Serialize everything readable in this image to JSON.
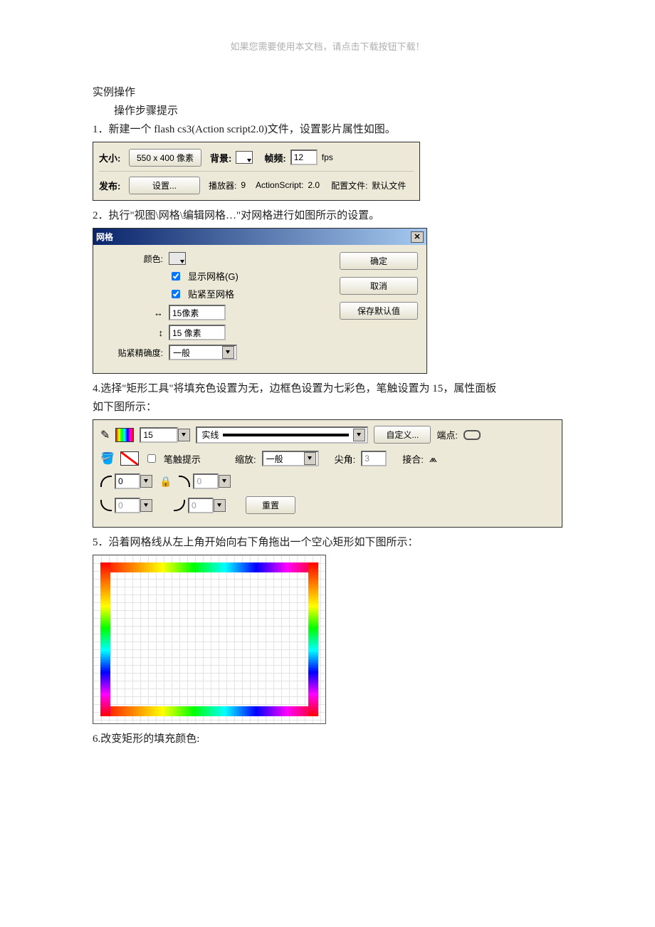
{
  "header_note": "如果您需要使用本文档，请点击下载按钮下载！",
  "intro": {
    "title": "实例操作",
    "subtitle": "操作步骤提示",
    "step1": "1．新建一个 flash cs3(Action script2.0)文件，设置影片属性如图。"
  },
  "panel_props": {
    "size_label": "大小:",
    "size_btn": "550 x 400 像素",
    "bg_label": "背景:",
    "fps_label": "帧频:",
    "fps_value": "12",
    "fps_unit": "fps",
    "publish_label": "发布:",
    "settings_btn": "设置...",
    "player_label": "播放器:",
    "player_value": "9",
    "as_label": "ActionScript:",
    "as_value": "2.0",
    "config_label": "配置文件:",
    "config_value": "默认文件"
  },
  "step2": "2．执行\"视图\\网格\\编辑网格…\"对网格进行如图所示的设置。",
  "grid_dialog": {
    "title": "网格",
    "color_label": "颜色:",
    "show_grid": "显示网格(G)",
    "snap_grid": "贴紧至网格",
    "h_value": "15像素",
    "v_value": "15 像素",
    "accuracy_label": "贴紧精确度:",
    "accuracy_value": "一般",
    "ok": "确定",
    "cancel": "取消",
    "save_default": "保存默认值"
  },
  "step4a": "4.选择\"矩形工具\"将填充色设置为无，边框色设置为七彩色，笔触设置为 15，属性面板",
  "step4b": "如下图所示：",
  "stroke_panel": {
    "stroke_size": "15",
    "line_style": "实线",
    "custom_btn": "自定义...",
    "cap_label": "端点:",
    "hint_label": "笔触提示",
    "scale_label": "缩放:",
    "scale_value": "一般",
    "miter_label": "尖角:",
    "miter_value": "3",
    "join_label": "接合:",
    "corner_val": "0",
    "reset_btn": "重置"
  },
  "step5": "5．沿着网格线从左上角开始向右下角拖出一个空心矩形如下图所示：",
  "step6": "6.改变矩形的填充颜色:"
}
